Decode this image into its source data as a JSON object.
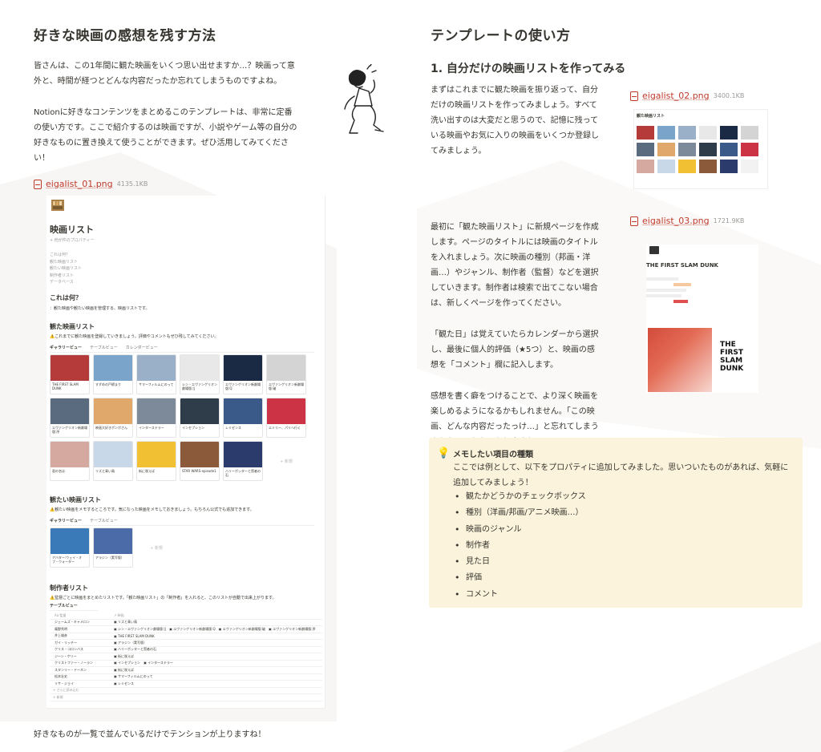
{
  "left": {
    "title": "好きな映画の感想を残す方法",
    "para1": "皆さんは、この1年間に観た映画をいくつ思い出せますか…？映画って意外と、時間が経つとどんな内容だったか忘れてしまうものですよね。",
    "para2": "Notionに好きなコンテンツをまとめるこのテンプレートは、非常に定番の使い方です。ここで紹介するのは映画ですが、小説やゲーム等の自分の好きなものに置き換えて使うことができます。ぜひ活用してみてください！",
    "file": {
      "name": "eigalist_01.png",
      "size": "4135.1KB"
    },
    "footer": "好きなものが一覧で並んでいるだけでテンションが上りますね！"
  },
  "mock": {
    "title": "映画リスト",
    "prop": "+ 他が件のプロパティー",
    "toc": [
      "これは何？",
      "観た映画リスト",
      "観たい映画リスト",
      "制作者リスト",
      "データベース"
    ],
    "sec1": "これは何？",
    "sec1_text": "：観た映画や観たい映画を管理する、映画リストです。",
    "sec2": "観た映画リスト",
    "sec2_text": "⚠️これまでに観た映画を登録していきましょう。評価やコメントもぜひ残してみてください。",
    "tabs1": [
      "ギャラリービュー",
      "テーブルビュー",
      "カレンダービュー"
    ],
    "watched": [
      "THE FIRST SLAM DUNK",
      "すずめの戸締まり",
      "サマーフィルムにのって",
      "シン・エヴァンゲリオン劇場版:||",
      "エヴァンゲリオン新劇場版:Q",
      "エヴァンゲリオン新劇場版:破",
      "エヴァンゲリオン新劇場版:序",
      "映画大好きポンポさん",
      "インターステラー",
      "インセプション",
      "レミゼンス",
      "エミリー、パリへ行く",
      "君の名は",
      "リズと青い鳥",
      "街に咲えば",
      "STAR WARS episode1",
      "ハリーポッターと賢者の石"
    ],
    "watched_colors": [
      "#b53a3a",
      "#7aa4c9",
      "#9ab0c8",
      "#e8e8e8",
      "#1a2a44",
      "#d4d4d4",
      "#5a6b80",
      "#e0a86a",
      "#7c8a99",
      "#2f3d4a",
      "#3a5a8a",
      "#cc3344",
      "#d6a9a0",
      "#c9d8e8",
      "#f1c033",
      "#8a5a3a",
      "#2b3b6b"
    ],
    "add_label": "+ 新規",
    "sec3": "観たい映画リスト",
    "sec3_text": "⚠️観たい映画をメモするところです。気になった映画をメモしておきましょう。もちろん公式でも追加できます。",
    "tabs2": [
      "ギャラリービュー",
      "テーブルビュー"
    ],
    "want": [
      "アバター:ウェイ・オブ・ウォーター",
      "アラジン（実写版）"
    ],
    "want_colors": [
      "#3a7ab8",
      "#4a6aa8"
    ],
    "sec4": "制作者リスト",
    "sec4_text": "⚠️監督ごとに映画をまとめたリストです。「観た映画リスト」の「制作者」を入れると、このリストが自動で出来上がります。",
    "tab3": "テーブルビュー",
    "table_header": [
      "Aa 監督",
      "↗ 映画"
    ],
    "table": [
      [
        "ジェームズ・キャメロン",
        [
          "リズと青い鳥"
        ]
      ],
      [
        "庵野秀明",
        [
          "シン・エヴァンゲリオン劇場版:||",
          "エヴァンゲリオン新劇場版:Q",
          "エヴァンゲリオン新劇場版:破",
          "エヴァンゲリオン新劇場版:序"
        ]
      ],
      [
        "井上雄彦",
        [
          "THE FIRST SLAM DUNK"
        ]
      ],
      [
        "ガイ・リッチー",
        [
          "アラジン（実写版）"
        ]
      ],
      [
        "クリス・コロンバス",
        [
          "ハリーポッターと賢者の石"
        ]
      ],
      [
        "ジーン・ケリー",
        [
          "街に咲えば"
        ]
      ],
      [
        "クリストファー・ノーラン",
        [
          "インセプション",
          "インターステラー"
        ]
      ],
      [
        "スタンリー・ドーネン",
        [
          "街に咲えば"
        ]
      ],
      [
        "松本壮史",
        [
          "サマーフィルムにのって"
        ]
      ],
      [
        "リサ・ジョイ",
        [
          "レミゼンス"
        ]
      ]
    ],
    "table_more": "+ さらに読み込む",
    "table_new": "+ 新規"
  },
  "right": {
    "title": "テンプレートの使い方",
    "step1": "1. 自分だけの映画リストを作ってみる",
    "para1": "まずはこれまでに観た映画を振り返って、自分だけの映画リストを作ってみましょう。すべて洗い出すのは大変だと思うので、記憶に残っている映画やお気に入りの映画をいくつか登録してみましょう。",
    "file2": {
      "name": "eigalist_02.png",
      "size": "3400.1KB"
    },
    "thumb2_title": "観た映画リスト",
    "thumb2_colors": [
      "#b53a3a",
      "#7aa4c9",
      "#9ab0c8",
      "#e8e8e8",
      "#1a2a44",
      "#d4d4d4",
      "#5a6b80",
      "#e0a86a",
      "#7c8a99",
      "#2f3d4a",
      "#3a5a8a",
      "#cc3344",
      "#d6a9a0",
      "#c9d8e8",
      "#f1c033",
      "#8a5a3a",
      "#2b3b6b",
      "#f2f2f2"
    ],
    "para2": "最初に「観た映画リスト」に新規ページを作成します。ページのタイトルには映画のタイトルを入れましょう。次に映画の種別（邦画・洋画…）やジャンル、制作者（監督）などを選択していきます。制作者は検索で出てこない場合は、新しくページを作ってください。",
    "file3": {
      "name": "eigalist_03.png",
      "size": "1721.9KB"
    },
    "thumb3_title": "THE FIRST SLAM DUNK",
    "poster_title": "THE FIRST SLAM DUNK",
    "para3": "「観た日」は覚えていたらカレンダーから選択し、最後に個人的評価（★5つ）と、映画の感想を「コメント」欄に記入します。",
    "para4": "感想を書く癖をつけることで、より深く映画を楽しめるようになるかもしれません。「この映画、どんな内容だったっけ…」と忘れてしまうようなこともなくなりますね！"
  },
  "callout": {
    "title": "メモしたい項目の種類",
    "body": "ここでは例として、以下をプロパティに追加してみました。思いついたものがあれば、気軽に追加してみましょう！",
    "items": [
      "観たかどうかのチェックボックス",
      "種別（洋画/邦画/アニメ映画…）",
      "映画のジャンル",
      "制作者",
      "見た日",
      "評価",
      "コメント"
    ]
  }
}
